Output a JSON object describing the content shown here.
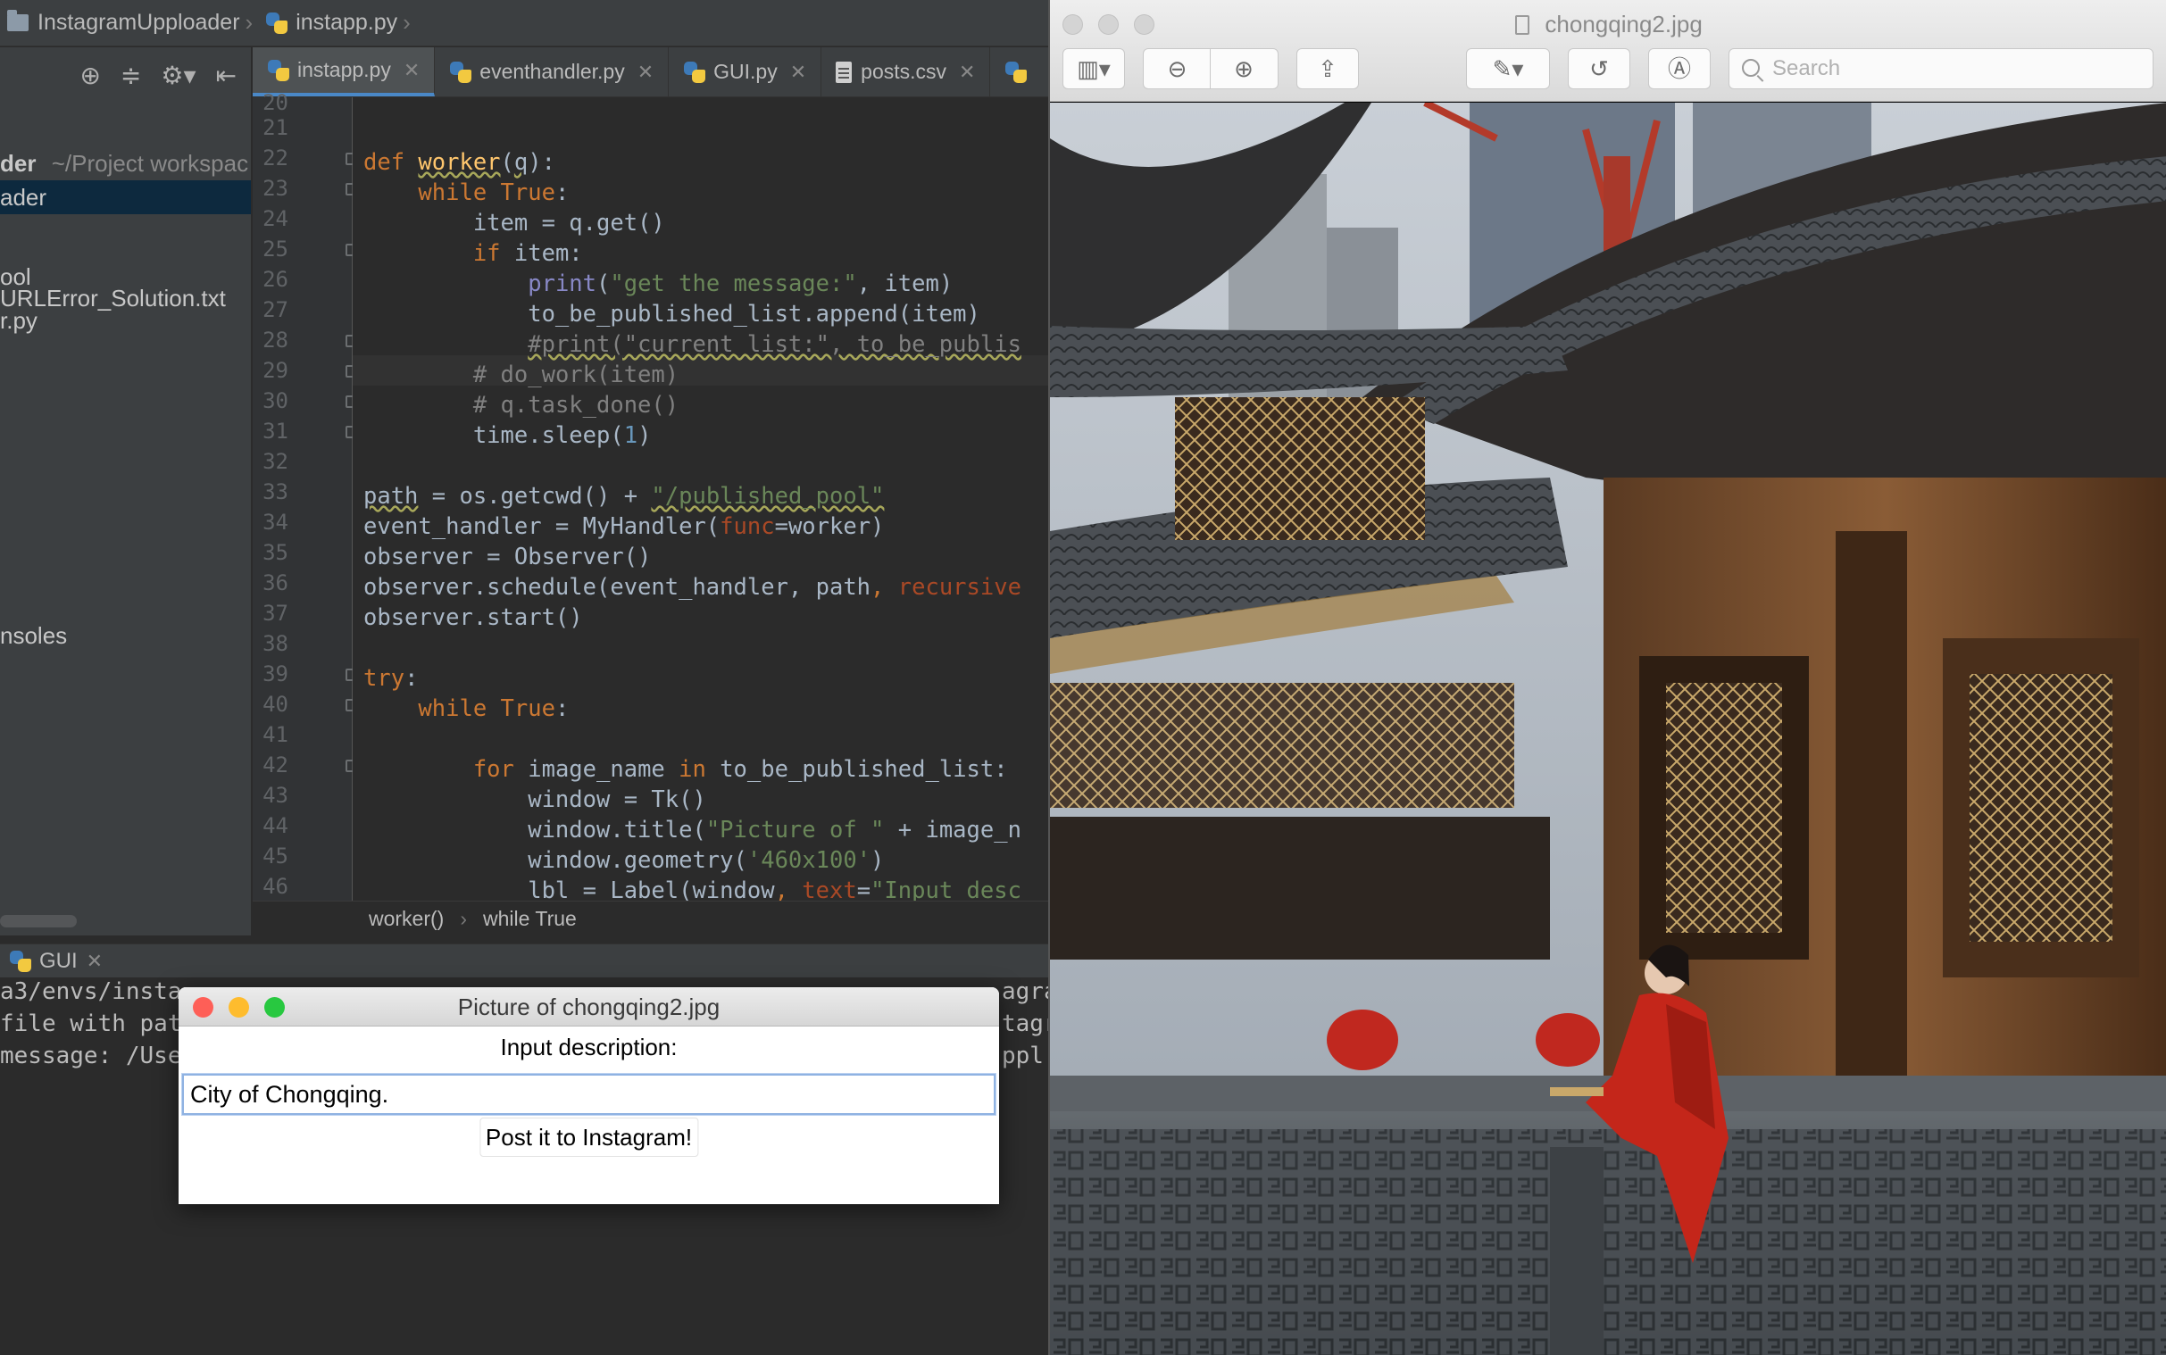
{
  "ide": {
    "breadcrumb": {
      "project": "InstagramUpploader",
      "file": "instapp.py"
    },
    "tabs": [
      {
        "label": "instapp.py",
        "active": true
      },
      {
        "label": "eventhandler.py",
        "active": false
      },
      {
        "label": "GUI.py",
        "active": false
      },
      {
        "label": "posts.csv",
        "active": false
      }
    ],
    "project_tree": {
      "root_name": "der",
      "root_path": "~/Project workspac",
      "selected": "ader",
      "items": [
        "ool",
        "URLError_Solution.txt",
        "r.py"
      ],
      "consoles": "nsoles"
    },
    "line_numbers": [
      "20",
      "21",
      "22",
      "23",
      "24",
      "25",
      "26",
      "27",
      "28",
      "29",
      "30",
      "31",
      "32",
      "33",
      "34",
      "35",
      "36",
      "37",
      "38",
      "39",
      "40",
      "41",
      "42",
      "43",
      "44",
      "45",
      "46"
    ],
    "editor_breadcrumb": {
      "func": "worker()",
      "block": "while True"
    },
    "run_tab": "GUI",
    "console_lines": [
      "a3/envs/insta",
      "file with pat",
      "message: /Use"
    ],
    "console_right": [
      "agra",
      "tagr",
      "ppl"
    ]
  },
  "dialog": {
    "title": "Picture of chongqing2.jpg",
    "label": "Input description:",
    "entry_value": "City of Chongqing.",
    "button": "Post it to Instagram!"
  },
  "preview": {
    "title": "chongqing2.jpg",
    "search_placeholder": "Search"
  },
  "colors": {
    "ide_bg": "#2b2b2b",
    "keyword": "#cc7832",
    "string": "#6a8759",
    "function": "#ffc66d",
    "comment": "#808080",
    "tab_accent": "#4a88c7",
    "mac_close": "#fe5f57",
    "mac_minimize": "#febc2e",
    "mac_zoom": "#28c840"
  }
}
